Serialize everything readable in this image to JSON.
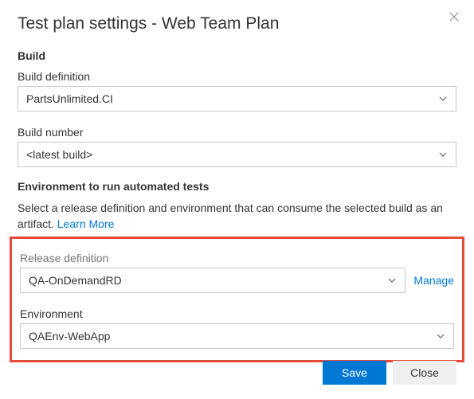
{
  "dialog": {
    "title": "Test plan settings - Web Team Plan"
  },
  "build": {
    "section_header": "Build",
    "definition_label": "Build definition",
    "definition_value": "PartsUnlimited.CI",
    "number_label": "Build number",
    "number_value": "<latest build>"
  },
  "environment": {
    "section_header": "Environment to run automated tests",
    "helper_text": "Select a release definition and environment that can consume the selected build as an artifact.  ",
    "learn_more": "Learn More",
    "release_definition_label": "Release definition",
    "release_definition_value": "QA-OnDemandRD",
    "manage_label": "Manage",
    "environment_label": "Environment",
    "environment_value": "QAEnv-WebApp"
  },
  "buttons": {
    "save": "Save",
    "close": "Close"
  }
}
